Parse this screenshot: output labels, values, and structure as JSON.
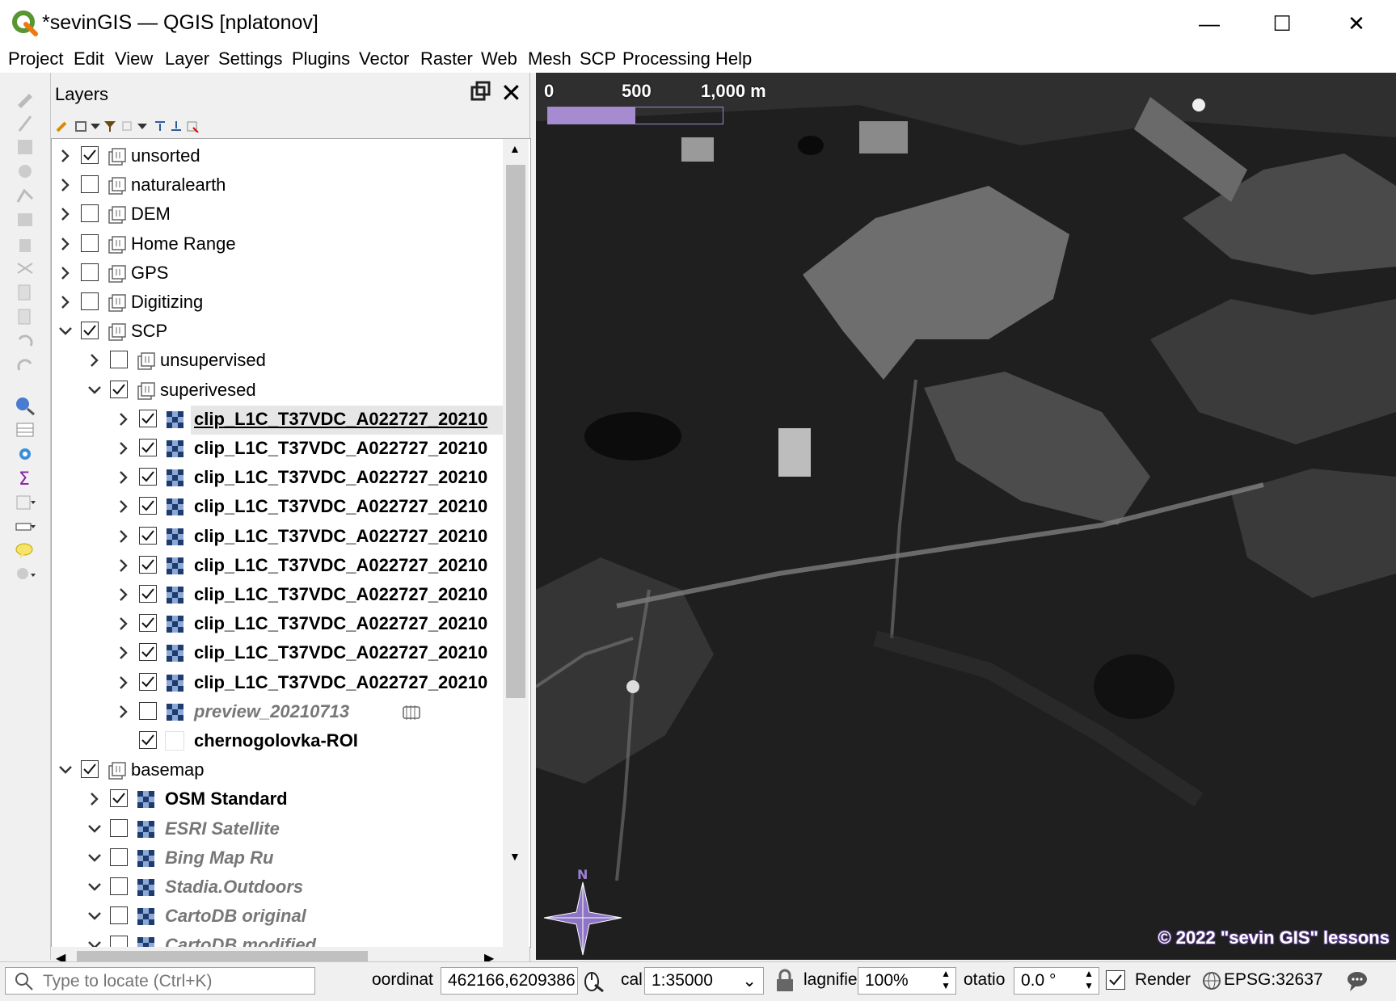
{
  "window": {
    "title": "*sevinGIS — QGIS [nplatonov]",
    "minimize": "—",
    "maximize": "☐",
    "close": "✕"
  },
  "menu": [
    "Project",
    "Edit",
    "View",
    "Layer",
    "Settings",
    "Plugins",
    "Vector",
    "Raster",
    "Web",
    "Mesh",
    "SCP",
    "Processing",
    "Help"
  ],
  "layers_panel": {
    "title": "Layers",
    "tree": [
      {
        "label": "unsorted",
        "checked": true,
        "kind": "group",
        "indent": 0,
        "expanded": false
      },
      {
        "label": "naturalearth",
        "checked": false,
        "kind": "group",
        "indent": 0,
        "expanded": false
      },
      {
        "label": "DEM",
        "checked": false,
        "kind": "group",
        "indent": 0,
        "expanded": false
      },
      {
        "label": "Home Range",
        "checked": false,
        "kind": "group",
        "indent": 0,
        "expanded": false
      },
      {
        "label": "GPS",
        "checked": false,
        "kind": "group",
        "indent": 0,
        "expanded": false
      },
      {
        "label": "Digitizing",
        "checked": false,
        "kind": "group",
        "indent": 0,
        "expanded": false
      },
      {
        "label": "SCP",
        "checked": true,
        "kind": "group",
        "indent": 0,
        "expanded": true
      },
      {
        "label": "unsupervised",
        "checked": false,
        "kind": "group",
        "indent": 1,
        "expanded": false
      },
      {
        "label": "superivesed",
        "checked": true,
        "kind": "group",
        "indent": 1,
        "expanded": true
      },
      {
        "label": "clip_L1C_T37VDC_A022727_20210",
        "checked": true,
        "kind": "raster",
        "indent": 2,
        "expanded": false,
        "style": "bold under",
        "selected": true
      },
      {
        "label": "clip_L1C_T37VDC_A022727_20210",
        "checked": true,
        "kind": "raster",
        "indent": 2,
        "expanded": false,
        "style": "bold"
      },
      {
        "label": "clip_L1C_T37VDC_A022727_20210",
        "checked": true,
        "kind": "raster",
        "indent": 2,
        "expanded": false,
        "style": "bold"
      },
      {
        "label": "clip_L1C_T37VDC_A022727_20210",
        "checked": true,
        "kind": "raster",
        "indent": 2,
        "expanded": false,
        "style": "bold"
      },
      {
        "label": "clip_L1C_T37VDC_A022727_20210",
        "checked": true,
        "kind": "raster",
        "indent": 2,
        "expanded": false,
        "style": "bold"
      },
      {
        "label": "clip_L1C_T37VDC_A022727_20210",
        "checked": true,
        "kind": "raster",
        "indent": 2,
        "expanded": false,
        "style": "bold"
      },
      {
        "label": "clip_L1C_T37VDC_A022727_20210",
        "checked": true,
        "kind": "raster",
        "indent": 2,
        "expanded": false,
        "style": "bold"
      },
      {
        "label": "clip_L1C_T37VDC_A022727_20210",
        "checked": true,
        "kind": "raster",
        "indent": 2,
        "expanded": false,
        "style": "bold"
      },
      {
        "label": "clip_L1C_T37VDC_A022727_20210",
        "checked": true,
        "kind": "raster",
        "indent": 2,
        "expanded": false,
        "style": "bold"
      },
      {
        "label": "clip_L1C_T37VDC_A022727_20210",
        "checked": true,
        "kind": "raster",
        "indent": 2,
        "expanded": false,
        "style": "bold"
      },
      {
        "label": "preview_20210713",
        "checked": false,
        "kind": "raster",
        "indent": 2,
        "expanded": false,
        "style": "ital"
      },
      {
        "label": "chernogolovka-ROI",
        "checked": true,
        "kind": "vector",
        "indent": 2,
        "expanded": null,
        "style": "bold"
      },
      {
        "label": "basemap",
        "checked": true,
        "kind": "group",
        "indent": 0,
        "expanded": true
      },
      {
        "label": "OSM Standard",
        "checked": true,
        "kind": "raster",
        "indent": 1,
        "expanded": false,
        "style": "bold"
      },
      {
        "label": "ESRI Satellite",
        "checked": false,
        "kind": "raster",
        "indent": 1,
        "expanded": true,
        "style": "ital"
      },
      {
        "label": "Bing Map Ru",
        "checked": false,
        "kind": "raster",
        "indent": 1,
        "expanded": true,
        "style": "ital"
      },
      {
        "label": "Stadia.Outdoors",
        "checked": false,
        "kind": "raster",
        "indent": 1,
        "expanded": true,
        "style": "ital"
      },
      {
        "label": "CartoDB original",
        "checked": false,
        "kind": "raster",
        "indent": 1,
        "expanded": true,
        "style": "ital"
      },
      {
        "label": "CartoDB modified",
        "checked": false,
        "kind": "raster",
        "indent": 1,
        "expanded": true,
        "style": "ital"
      }
    ]
  },
  "map": {
    "scale_labels": [
      "0",
      "500",
      "1,000 m"
    ],
    "copyright": "© 2022 \"sevin GIS\" lessons",
    "north_label": "N"
  },
  "statusbar": {
    "locator_placeholder": "Type to locate (Ctrl+K)",
    "coordinate_label": "oordinat",
    "coordinate_value": "462166,6209386",
    "scale_label": "cal",
    "scale_value": "1:35000",
    "magnifier_label": "lagnifie",
    "magnifier_value": "100%",
    "rotation_label": "otatio",
    "rotation_value": "0.0 °",
    "render_label": "Render",
    "crs": "EPSG:32637"
  }
}
